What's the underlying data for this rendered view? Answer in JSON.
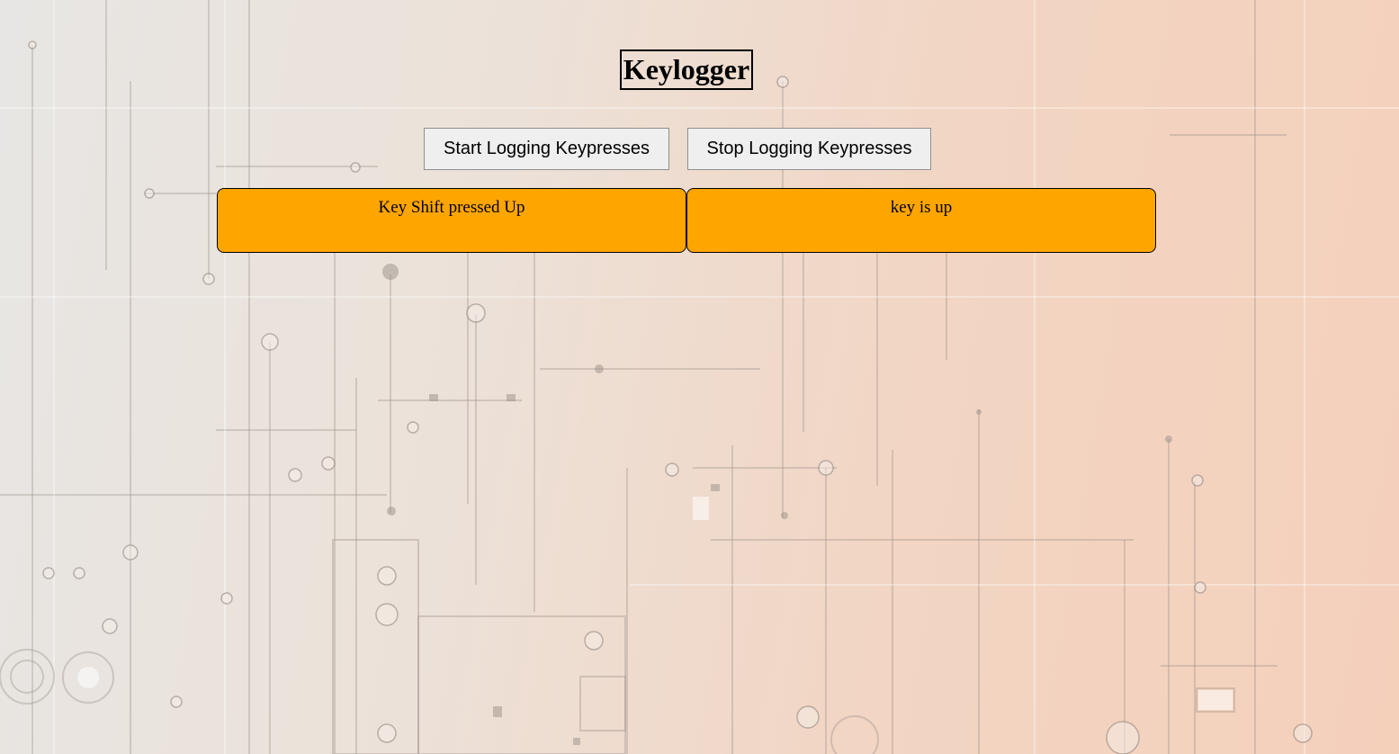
{
  "page": {
    "title": "Keylogger"
  },
  "controls": {
    "start_label": "Start Logging Keypresses",
    "stop_label": "Stop Logging Keypresses"
  },
  "log": {
    "last_key_event": "Key Shift pressed Up",
    "key_state": "key is up"
  },
  "colors": {
    "log_box_background": "#ffa500",
    "button_background": "#efefef",
    "page_background_left": "#e7e6e4",
    "page_background_right": "#f4d0bb"
  },
  "background": {
    "description_icon": "circuit-board-pattern"
  }
}
